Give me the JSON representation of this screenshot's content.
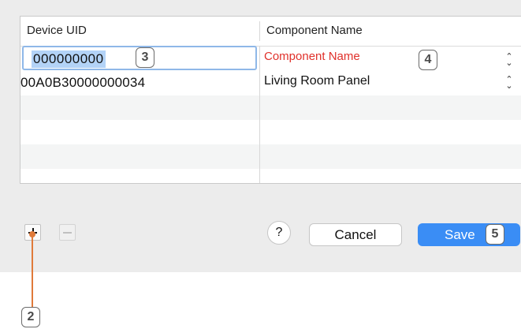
{
  "table": {
    "columns": [
      "Device UID",
      "Component Name"
    ],
    "rows": [
      {
        "uid": "000000000",
        "component": "Component Name",
        "editing": true,
        "component_is_placeholder": true
      },
      {
        "uid": "00A0B30000000034",
        "component": "Living Room Panel",
        "editing": false,
        "component_is_placeholder": false
      }
    ]
  },
  "toolbar": {
    "help_label": "?",
    "cancel_label": "Cancel",
    "save_label": "Save"
  },
  "icons": {
    "add": "plus-icon",
    "remove": "minus-icon",
    "stepper": "chevron-up-down-icon"
  },
  "callouts": [
    "2",
    "3",
    "4",
    "5"
  ],
  "colors": {
    "accent": "#3a8df5",
    "placeholder_red": "#e0312b",
    "callout_line": "#e07a3a",
    "selection": "#b3d3f7"
  }
}
